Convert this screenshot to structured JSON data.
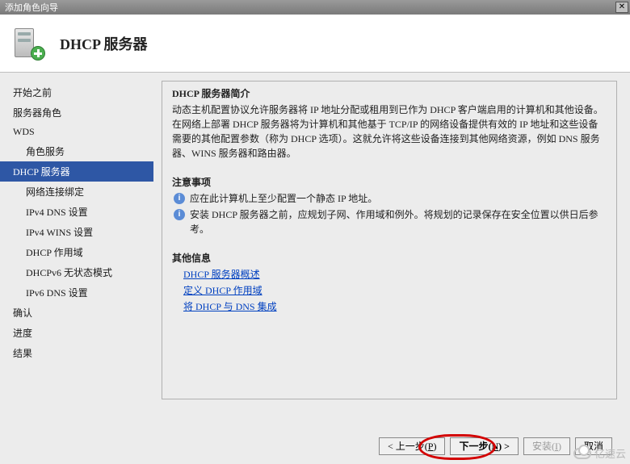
{
  "window": {
    "title": "添加角色向导",
    "close_glyph": "✕"
  },
  "header": {
    "title": "DHCP 服务器"
  },
  "sidebar": {
    "items": [
      {
        "label": "开始之前",
        "indent": 0,
        "selected": false
      },
      {
        "label": "服务器角色",
        "indent": 0,
        "selected": false
      },
      {
        "label": "WDS",
        "indent": 0,
        "selected": false
      },
      {
        "label": "角色服务",
        "indent": 1,
        "selected": false
      },
      {
        "label": "DHCP 服务器",
        "indent": 0,
        "selected": true
      },
      {
        "label": "网络连接绑定",
        "indent": 1,
        "selected": false
      },
      {
        "label": "IPv4 DNS 设置",
        "indent": 1,
        "selected": false
      },
      {
        "label": "IPv4 WINS 设置",
        "indent": 1,
        "selected": false
      },
      {
        "label": "DHCP 作用域",
        "indent": 1,
        "selected": false
      },
      {
        "label": "DHCPv6 无状态模式",
        "indent": 1,
        "selected": false
      },
      {
        "label": "IPv6 DNS 设置",
        "indent": 1,
        "selected": false
      },
      {
        "label": "确认",
        "indent": 0,
        "selected": false
      },
      {
        "label": "进度",
        "indent": 0,
        "selected": false
      },
      {
        "label": "结果",
        "indent": 0,
        "selected": false
      }
    ]
  },
  "content": {
    "intro_title": "DHCP 服务器简介",
    "intro_body": "动态主机配置协议允许服务器将 IP 地址分配或租用到已作为 DHCP 客户端启用的计算机和其他设备。在网络上部署 DHCP 服务器将为计算机和其他基于 TCP/IP 的网络设备提供有效的 IP 地址和这些设备需要的其他配置参数（称为 DHCP 选项）。这就允许将这些设备连接到其他网络资源，例如 DNS 服务器、WINS 服务器和路由器。",
    "notes_title": "注意事项",
    "notes": [
      "应在此计算机上至少配置一个静态 IP 地址。",
      "安装 DHCP 服务器之前，应规划子网、作用域和例外。将规划的记录保存在安全位置以供日后参考。"
    ],
    "other_title": "其他信息",
    "links": [
      "DHCP 服务器概述",
      "定义 DHCP 作用域",
      "将 DHCP 与 DNS 集成"
    ]
  },
  "footer": {
    "prev": "< 上一步(P)",
    "next": "下一步(N) >",
    "install": "安装(I)",
    "cancel": "取消"
  },
  "watermark": "亿速云",
  "info_glyph": "i"
}
